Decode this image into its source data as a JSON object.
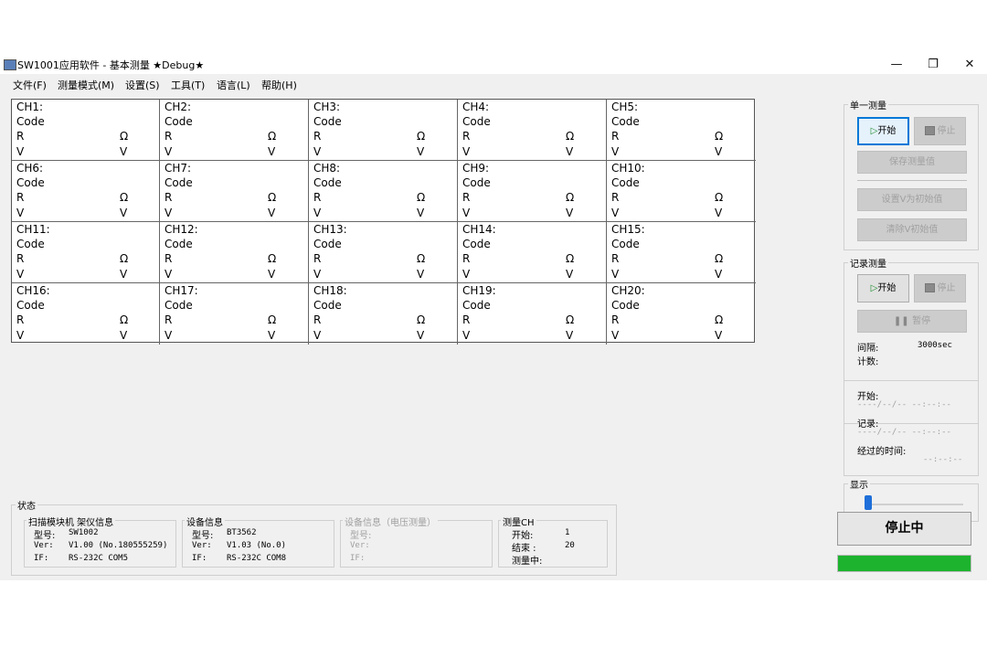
{
  "window": {
    "title": "SW1001应用软件 - 基本测量 ★Debug★",
    "minimize": "—",
    "maximize": "❐",
    "close": "✕"
  },
  "menu": [
    "文件(F)",
    "测量模式(M)",
    "设置(S)",
    "工具(T)",
    "语言(L)",
    "帮助(H)"
  ],
  "grid": {
    "code_label": "Code",
    "r_label": "R",
    "v_label": "V",
    "r_unit": "Ω",
    "v_unit": "V",
    "channels": [
      "CH1:",
      "CH2:",
      "CH3:",
      "CH4:",
      "CH5:",
      "CH6:",
      "CH7:",
      "CH8:",
      "CH9:",
      "CH10:",
      "CH11:",
      "CH12:",
      "CH13:",
      "CH14:",
      "CH15:",
      "CH16:",
      "CH17:",
      "CH18:",
      "CH19:",
      "CH20:"
    ]
  },
  "single": {
    "title": "单一测量",
    "start": "开始",
    "stop": "停止",
    "save": "保存测量值",
    "set_init": "设置V为初始值",
    "clear_init": "清除V初始值"
  },
  "record": {
    "title": "记录测量",
    "start": "开始",
    "stop": "停止",
    "pause": "暂停",
    "interval_label": "间隔:",
    "interval_value": "3000sec",
    "count_label": "计数:"
  },
  "times": {
    "start_label": "开始:",
    "start_value": "----/--/-- --:--:--",
    "record_label": "记录:",
    "record_value": "----/--/-- --:--:--",
    "elapsed_label": "经过的时间:",
    "elapsed_value": "--:--:--"
  },
  "display": {
    "title": "显示",
    "slider_level": 0.0
  },
  "stop_button": "停止中",
  "progress": 1.0,
  "status": {
    "title": "状态",
    "scanner": {
      "title": "扫描模块机  架仪信息",
      "model_label": "型号:",
      "model": "SW1002",
      "ver_label": "Ver:",
      "ver": "V1.00 (No.180555259)",
      "if_label": "IF:",
      "if": "RS-232C COM5"
    },
    "device": {
      "title": "设备信息",
      "model_label": "型号:",
      "model": "BT3562",
      "ver_label": "Ver:",
      "ver": "V1.03 (No.0)",
      "if_label": "IF:",
      "if": "RS-232C COM8"
    },
    "device_v": {
      "title": "设备信息（电压测量）",
      "model_label": "型号:",
      "ver_label": "Ver:",
      "if_label": "IF:"
    },
    "measure": {
      "title": "测量CH",
      "start_label": "开始:",
      "start": "1",
      "end_label": "结束  :",
      "end": "20",
      "measuring_label": "测量中:"
    }
  },
  "colors": {
    "progress": "#1db32f",
    "accent": "#0078d7",
    "slider": "#1e6fd9"
  }
}
